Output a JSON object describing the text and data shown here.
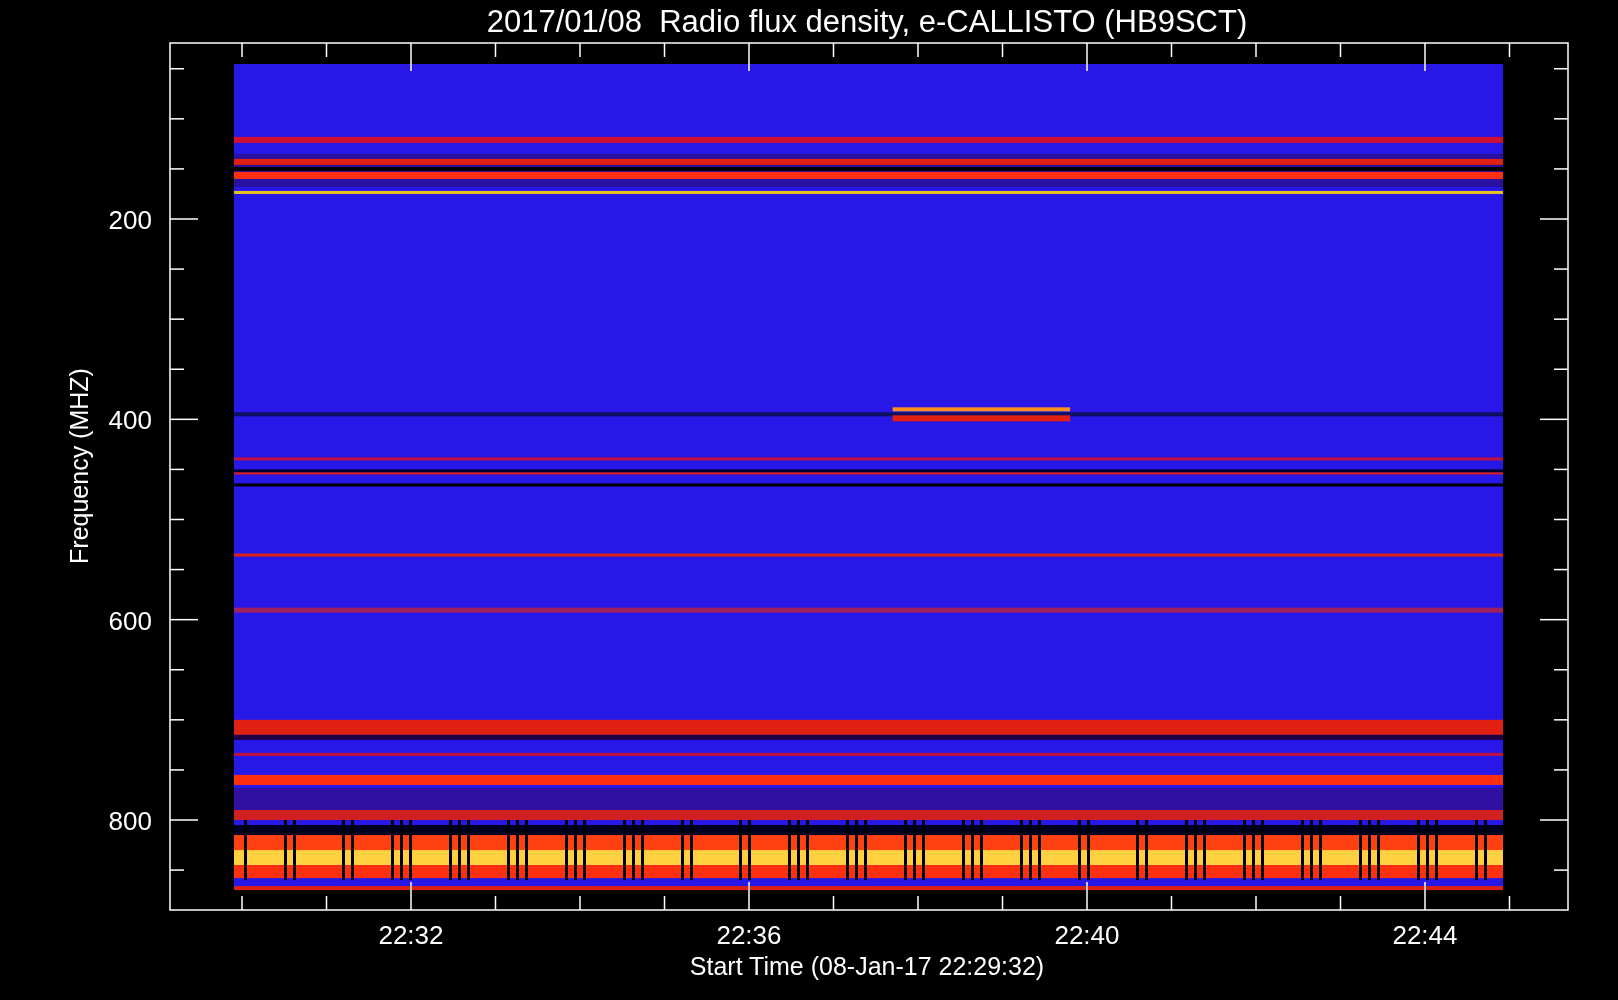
{
  "chart": {
    "title": "2017/01/08  Radio flux density, e-CALLISTO (HB9SCT)",
    "y_axis": {
      "label": "Frequency (MHZ)",
      "ticks": [
        "200",
        "400",
        "600",
        "800"
      ]
    },
    "x_axis": {
      "label": "Start Time (08-Jan-17 22:29:32)",
      "ticks": [
        "22:32",
        "22:36",
        "22:40",
        "22:44"
      ]
    }
  }
}
